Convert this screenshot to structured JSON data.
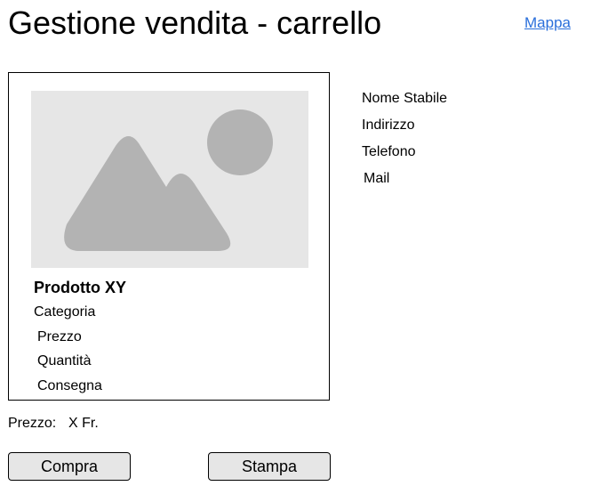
{
  "header": {
    "title": "Gestione vendita - carrello",
    "map_link": "Mappa"
  },
  "product": {
    "image_icon": "image-placeholder-icon",
    "name": "Prodotto XY",
    "category": "Categoria",
    "price": "Prezzo",
    "quantity": "Quantità",
    "delivery": "Consegna"
  },
  "store": {
    "name": "Nome Stabile",
    "address": "Indirizzo",
    "phone": "Telefono",
    "mail": "Mail"
  },
  "total": {
    "label": "Prezzo:",
    "value": "X Fr."
  },
  "actions": {
    "buy": "Compra",
    "print": "Stampa"
  },
  "colors": {
    "link": "#2a6fdb",
    "placeholder_bg": "#e6e6e6",
    "placeholder_shape": "#b3b3b3",
    "button_bg": "#e6e6e6"
  }
}
